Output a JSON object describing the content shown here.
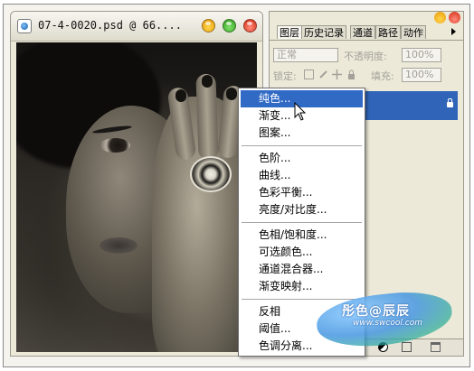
{
  "document": {
    "title": "07-4-0020.psd @ 66....",
    "icons": {
      "app": "photoshop-icon",
      "buttons": [
        "minimize-button",
        "maximize-button",
        "close-button"
      ]
    }
  },
  "panel": {
    "tabs": [
      "图层",
      "历史记录",
      "通道",
      "路径",
      "动作"
    ],
    "blend_mode": "正常",
    "opacity_label": "不透明度:",
    "opacity_value": "100%",
    "lock_label": "锁定:",
    "fill_label": "填充:",
    "fill_value": "100%"
  },
  "menu": {
    "groups": [
      [
        "纯色...",
        "渐变...",
        "图案..."
      ],
      [
        "色阶...",
        "曲线...",
        "色彩平衡...",
        "亮度/对比度..."
      ],
      [
        "色相/饱和度...",
        "可选颜色...",
        "通道混合器...",
        "渐变映射..."
      ],
      [
        "反相",
        "阈值...",
        "色调分离..."
      ]
    ],
    "highlighted": "纯色..."
  },
  "watermark": {
    "title": "彤色@辰辰",
    "url": "www.swcool.com"
  },
  "colors": {
    "highlight": "#316ac5",
    "layer_selected": "#2f64b8",
    "window_bg": "#ece9d8"
  }
}
